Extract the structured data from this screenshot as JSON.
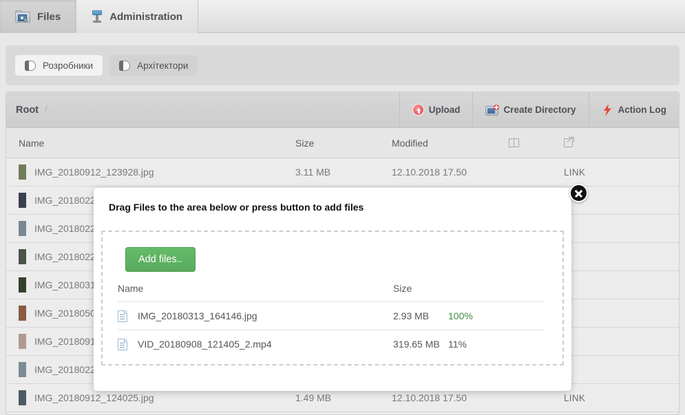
{
  "tabs": [
    {
      "label": "Files",
      "icon": "folder-image-icon",
      "active": true
    },
    {
      "label": "Administration",
      "icon": "admin-tower-icon",
      "active": false
    }
  ],
  "role_filters": [
    {
      "label": "Розробники",
      "icon": "role-icon",
      "selected": true
    },
    {
      "label": "Архітектори",
      "icon": "role-icon",
      "selected": false
    }
  ],
  "breadcrumb": {
    "root": "Root",
    "separator": "/"
  },
  "actions": [
    {
      "label": "Upload",
      "icon": "upload-icon"
    },
    {
      "label": "Create Directory",
      "icon": "new-folder-icon"
    },
    {
      "label": "Action Log",
      "icon": "lightning-bolt-icon"
    }
  ],
  "table": {
    "headers": {
      "name": "Name",
      "size": "Size",
      "modified": "Modified",
      "book_icon": "book-icon",
      "link_icon": "external-link-icon"
    },
    "rows": [
      {
        "name": "IMG_20180912_123928.jpg",
        "size": "3.11 MB",
        "modified": "12.10.2018 17.50",
        "link": "LINK",
        "thumb": "#6f7d5c"
      },
      {
        "name": "IMG_2018022",
        "size": "",
        "modified": "",
        "link": "",
        "thumb": "#39414c"
      },
      {
        "name": "IMG_2018022",
        "size": "",
        "modified": "",
        "link": "",
        "thumb": "#7b8893"
      },
      {
        "name": "IMG_2018022",
        "size": "",
        "modified": "",
        "link": "",
        "thumb": "#4b5548"
      },
      {
        "name": "IMG_2018031",
        "size": "",
        "modified": "",
        "link": "",
        "thumb": "#33412c"
      },
      {
        "name": "IMG_2018050",
        "size": "",
        "modified": "",
        "link": "",
        "thumb": "#8a5b42"
      },
      {
        "name": "IMG_2018091",
        "size": "",
        "modified": "",
        "link": "",
        "thumb": "#b09a90"
      },
      {
        "name": "IMG_2018022",
        "size": "",
        "modified": "",
        "link": "",
        "thumb": "#7c8b93"
      },
      {
        "name": "IMG_20180912_124025.jpg",
        "size": "1.49 MB",
        "modified": "12.10.2018 17.50",
        "link": "LINK",
        "thumb": "#4c5a63"
      }
    ]
  },
  "modal": {
    "title": "Drag Files to the area below or press button to add files",
    "add_button": "Add files..",
    "close_icon": "close-icon",
    "headers": {
      "name": "Name",
      "size": "Size"
    },
    "uploads": [
      {
        "name": "IMG_20180313_164146.jpg",
        "size": "2.93 MB",
        "progress": "100%",
        "done": true
      },
      {
        "name": "VID_20180908_121405_2.mp4",
        "size": "319.65 MB",
        "progress": "11%",
        "done": false
      }
    ]
  },
  "colors": {
    "accent_green": "#58ab5d",
    "progress_done": "#3d8b40",
    "upload_red": "#e04848"
  }
}
